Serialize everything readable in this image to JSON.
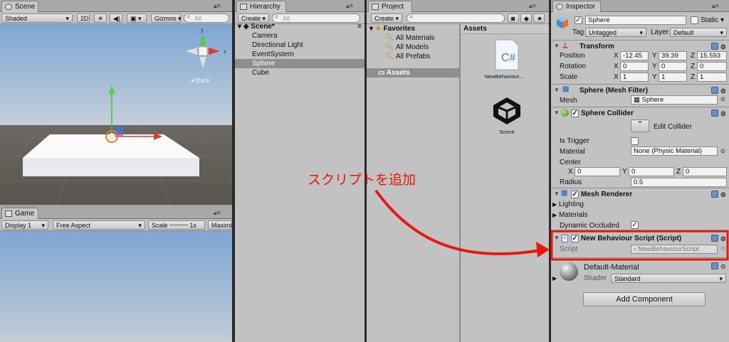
{
  "scene": {
    "tab": "Scene",
    "shading": "Shaded",
    "mode_2d": "2D",
    "gizmos": "Gizmos",
    "search_placeholder": "All",
    "back_label": "Back"
  },
  "game": {
    "tab": "Game",
    "display": "Display 1",
    "aspect": "Free Aspect",
    "scale_label": "Scale",
    "scale_value": "1x",
    "maximize": "Maximiz"
  },
  "hierarchy": {
    "tab": "Hierarchy",
    "create": "Create",
    "search_placeholder": "All",
    "scene_name": "Scene*",
    "items": [
      "Camera",
      "Directional Light",
      "EventSystem",
      "Sphere",
      "Cube"
    ]
  },
  "project": {
    "tab": "Project",
    "create": "Create",
    "favorites": "Favorites",
    "fav_items": [
      "All Materials",
      "All Models",
      "All Prefabs"
    ],
    "tree_assets": "Assets",
    "assets_header": "Assets",
    "asset_items": [
      "NewBehaviour...",
      "Scene"
    ]
  },
  "inspector": {
    "tab": "Inspector",
    "object_name": "Sphere",
    "static_label": "Static",
    "tag_label": "Tag",
    "tag_value": "Untagged",
    "layer_label": "Layer",
    "layer_value": "Default",
    "transform": {
      "title": "Transform",
      "rows": [
        {
          "label": "Position",
          "x": "-12.45",
          "y": "39.39",
          "z": "15.593"
        },
        {
          "label": "Rotation",
          "x": "0",
          "y": "0",
          "z": "0"
        },
        {
          "label": "Scale",
          "x": "1",
          "y": "1",
          "z": "1"
        }
      ],
      "axis_x": "X",
      "axis_y": "Y",
      "axis_z": "Z"
    },
    "mesh_filter": {
      "title": "Sphere (Mesh Filter)",
      "mesh_label": "Mesh",
      "mesh_value": "Sphere"
    },
    "collider": {
      "title": "Sphere Collider",
      "edit": "Edit Collider",
      "is_trigger": "Is Trigger",
      "material_label": "Material",
      "material_value": "None (Physic Material)",
      "center_label": "Center",
      "cx": "0",
      "cy": "0",
      "cz": "0",
      "radius_label": "Radius",
      "radius_value": "0.5"
    },
    "renderer": {
      "title": "Mesh Renderer",
      "lighting": "Lighting",
      "materials": "Materials",
      "dynamic": "Dynamic Occluded"
    },
    "script": {
      "title": "New Behaviour Script (Script)",
      "label": "Script",
      "value": "NewBehaviourScript"
    },
    "material": {
      "name": "Default-Material",
      "shader_label": "Shader",
      "shader_value": "Standard"
    },
    "add_component": "Add Component"
  },
  "annotation": {
    "text": "スクリプトを追加",
    "color": "#e8170f"
  }
}
